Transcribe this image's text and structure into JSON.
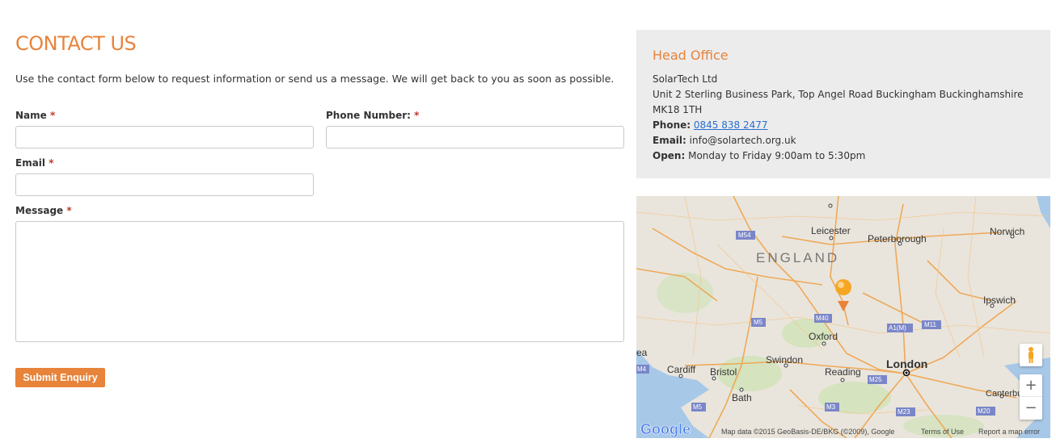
{
  "contact": {
    "title": "CONTACT US",
    "intro": "Use the contact form below to request information or send us a message. We will get back to you as soon as possible.",
    "required_mark": "*",
    "name_label": "Name",
    "phone_label": "Phone Number:",
    "email_label": "Email",
    "message_label": "Message",
    "submit_label": "Submit Enquiry"
  },
  "office": {
    "heading": "Head Office",
    "company": "SolarTech Ltd",
    "address": "Unit 2 Sterling Business Park, Top Angel Road Buckingham Buckinghamshire",
    "postcode": "MK18 1TH",
    "phone_label": "Phone:",
    "phone": "0845 838 2477",
    "email_label": "Email:",
    "email": "info@solartech.org.uk",
    "open_label": "Open:",
    "open": "Monday to Friday 9:00am to 5:30pm"
  },
  "map": {
    "region_label": "ENGLAND",
    "places": [
      "Leicester",
      "Peterborough",
      "Norwich",
      "Ipswich",
      "Oxford",
      "London",
      "Swindon",
      "Reading",
      "Cardiff",
      "Bristol",
      "Bath",
      "Canterbury",
      "ea"
    ],
    "roads": [
      "M54",
      "M40",
      "M5",
      "A1(M)",
      "M11",
      "M4",
      "M25",
      "M3",
      "M23",
      "M20",
      "M5"
    ],
    "logo": "Google",
    "attribution": "Map data ©2015 GeoBasis-DE/BKG (©2009), Google",
    "terms": "Terms of Use",
    "report": "Report a map error",
    "zoom_in": "+",
    "zoom_out": "−",
    "colors": {
      "land": "#e9e5dc",
      "water": "#a8c8e8",
      "road": "#f0a24a",
      "road_badge": "#7a86c8",
      "green": "#cfe2b8",
      "pin": "#f5a623"
    }
  }
}
